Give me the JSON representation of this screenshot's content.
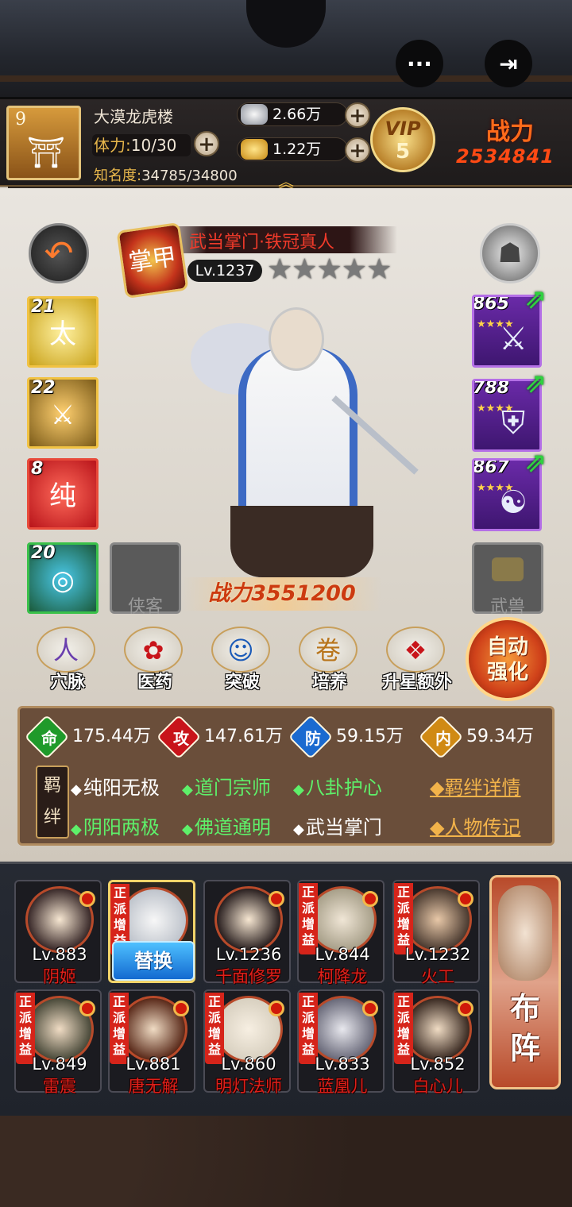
{
  "topbar": {
    "more_icon": "···",
    "exit_icon": "⇥"
  },
  "player": {
    "level": "9",
    "name": "大漠龙虎楼",
    "stamina_label": "体力:",
    "stamina_value": "10/30",
    "fame_label": "知名度:",
    "fame_value": "34785/34800",
    "silver": "2.66万",
    "gold": "1.22万",
    "vip_label": "VIP",
    "vip_level": "5",
    "power_label": "战力",
    "power_value": "2534841"
  },
  "hero": {
    "title": "武当掌门·铁冠真人",
    "badge": "掌甲",
    "level": "Lv.1237",
    "stars": "★★★★★",
    "power": "战力3551200"
  },
  "skills": [
    {
      "num": "21",
      "glyph": "太",
      "color": "#c9a21a"
    },
    {
      "num": "22",
      "glyph": "⚔",
      "color": "#7a5a18"
    },
    {
      "num": "8",
      "glyph": "纯",
      "color": "#b8141a"
    },
    {
      "num": "20",
      "glyph": "◎",
      "color": "#1a5a3a"
    }
  ],
  "slots": {
    "left": "侠客",
    "right": "武兽"
  },
  "equipment": [
    {
      "num": "865",
      "glyph": "⚔"
    },
    {
      "num": "788",
      "glyph": "⛨"
    },
    {
      "num": "867",
      "glyph": "☯"
    }
  ],
  "functions": [
    {
      "label": "穴脉",
      "icon": "人"
    },
    {
      "label": "医药",
      "icon": "✿"
    },
    {
      "label": "突破",
      "icon": "☺"
    },
    {
      "label": "培养",
      "icon": "卷"
    },
    {
      "label": "升星额外",
      "icon": "❖"
    }
  ],
  "auto_button": "自动强化",
  "attributes": [
    {
      "icon": "命",
      "value": "175.44万",
      "color": "#1f9a2a"
    },
    {
      "icon": "攻",
      "value": "147.61万",
      "color": "#c8141a"
    },
    {
      "icon": "防",
      "value": "59.15万",
      "color": "#1a6ad0"
    },
    {
      "icon": "内",
      "value": "59.34万",
      "color": "#d08a14"
    }
  ],
  "bond_sign": "羁绊",
  "bonds": [
    {
      "text": "纯阳无极",
      "active": false
    },
    {
      "text": "道门宗师",
      "active": true
    },
    {
      "text": "八卦护心",
      "active": true
    },
    {
      "text": "阴阳两极",
      "active": true
    },
    {
      "text": "佛道通明",
      "active": true
    },
    {
      "text": "武当掌门",
      "active": false
    }
  ],
  "links": {
    "bond_detail": "◆羁绊详情",
    "biography": "◆人物传记"
  },
  "roster": [
    {
      "level": "Lv.883",
      "name": "阴姬",
      "tag": ""
    },
    {
      "level": "",
      "name": "",
      "tag": "正派增益",
      "replace": "替换"
    },
    {
      "level": "Lv.1236",
      "name": "千面修罗",
      "tag": ""
    },
    {
      "level": "Lv.844",
      "name": "柯降龙",
      "tag": "正派增益"
    },
    {
      "level": "Lv.1232",
      "name": "火工",
      "tag": "正派增益"
    },
    {
      "level": "Lv.849",
      "name": "雷震",
      "tag": "正派增益"
    },
    {
      "level": "Lv.881",
      "name": "唐无解",
      "tag": "正派增益"
    },
    {
      "level": "Lv.860",
      "name": "明灯法师",
      "tag": "正派增益"
    },
    {
      "level": "Lv.833",
      "name": "蓝凰儿",
      "tag": "正派增益"
    },
    {
      "level": "Lv.852",
      "name": "白心儿",
      "tag": "正派增益"
    }
  ],
  "formation": "布阵"
}
